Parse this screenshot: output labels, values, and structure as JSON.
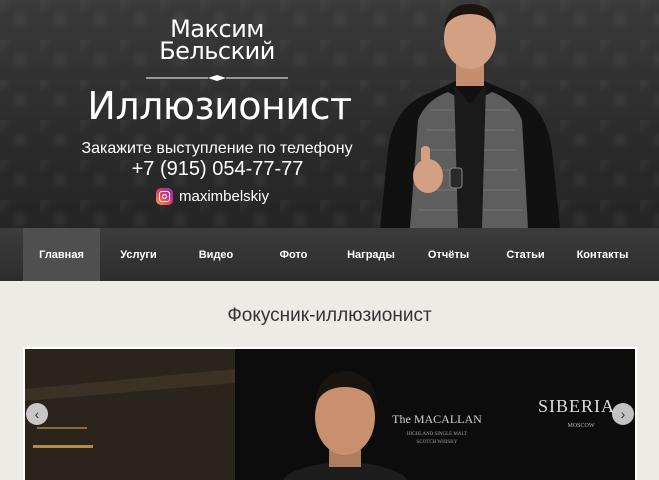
{
  "header": {
    "logo_first_name": "Максим",
    "logo_last_name": "Бельский",
    "title": "Иллюзионист",
    "order_text": "Закажите выступление по телефону",
    "phone": "+7 (915) 054-77-77",
    "instagram": "maximbelskiy",
    "instagram_icon": "instagram-icon"
  },
  "nav": {
    "items": [
      {
        "label": "Главная",
        "active": true
      },
      {
        "label": "Услуги"
      },
      {
        "label": "Видео"
      },
      {
        "label": "Фото"
      },
      {
        "label": "Награды"
      },
      {
        "label": "Отчёты"
      },
      {
        "label": "Статьи"
      },
      {
        "label": "Контакты"
      }
    ]
  },
  "main": {
    "page_title": "Фокусник-иллюзионист",
    "slider": {
      "backdrop_brands": [
        "SIBERIA",
        "MOSCOW",
        "The MACALLAN",
        "HIGHLAND SINGLE MALT",
        "SCOTCH WHISKY"
      ],
      "prev_icon": "chevron-left-icon",
      "next_icon": "chevron-right-icon"
    }
  },
  "colors": {
    "header_bg": "#2b2b2b",
    "nav_bg": "#333333",
    "nav_active": "#4f4f4f",
    "page_bg": "#ecebe6"
  }
}
